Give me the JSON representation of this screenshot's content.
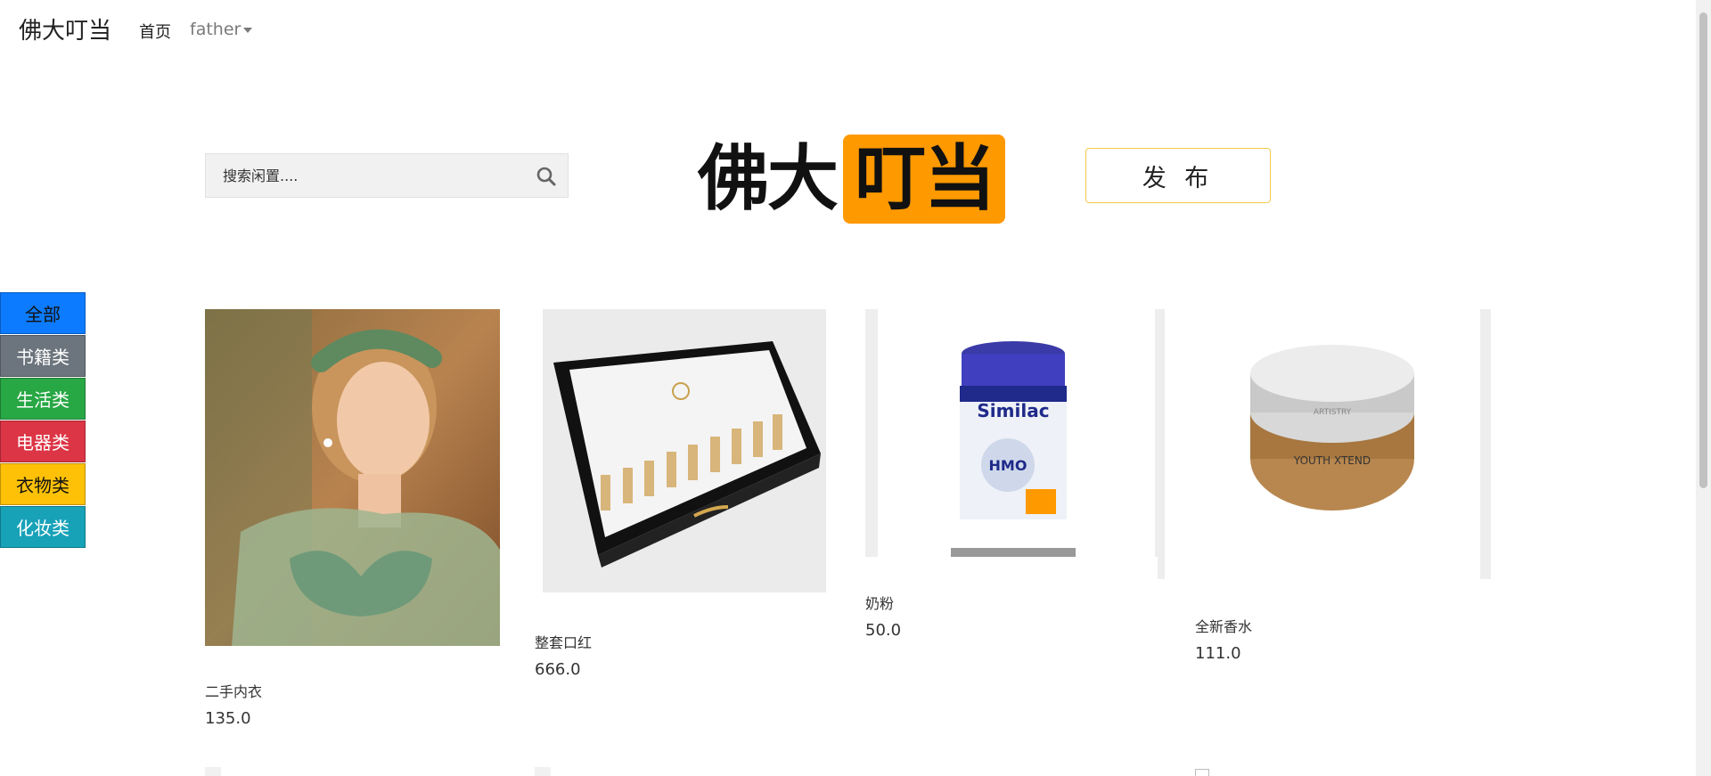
{
  "nav": {
    "brand": "佛大叮当",
    "home": "首页",
    "user": "father"
  },
  "search": {
    "placeholder": "搜索闲置...."
  },
  "logo": {
    "left": "佛大",
    "right": "叮当"
  },
  "publish_label": "发 布",
  "categories": [
    "全部",
    "书籍类",
    "生活类",
    "电器类",
    "衣物类",
    "化妆类"
  ],
  "products": [
    {
      "name": "二手内衣",
      "price": "135.0"
    },
    {
      "name": "整套口红",
      "price": "666.0"
    },
    {
      "name": "奶粉",
      "price": "50.0"
    },
    {
      "name": "全新香水",
      "price": "111.0"
    }
  ],
  "product_image_texts": {
    "milk_brand": "Similac",
    "milk_sub": "HMO",
    "jar_label": "YOUTH XTEND",
    "jar_brand": "ARTISTRY"
  },
  "colors": {
    "accent": "#ff9900",
    "publish_border": "#f2c94c"
  }
}
